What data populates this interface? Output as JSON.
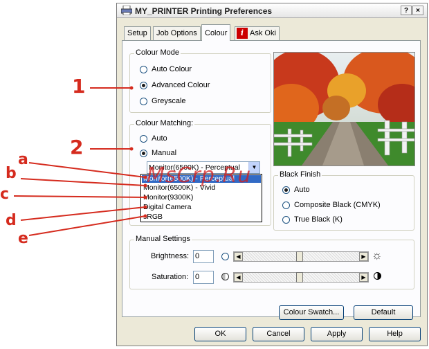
{
  "window": {
    "title": "MY_PRINTER Printing Preferences",
    "help_btn": "?",
    "close_btn": "×"
  },
  "tabs": [
    {
      "label": "Setup"
    },
    {
      "label": "Job Options"
    },
    {
      "label": "Colour"
    },
    {
      "label": "Ask Oki"
    }
  ],
  "colour_mode": {
    "title": "Colour Mode",
    "options": [
      "Auto Colour",
      "Advanced Colour",
      "Greyscale"
    ],
    "selected": 1
  },
  "colour_matching": {
    "title": "Colour Matching:",
    "options": [
      "Auto",
      "Manual"
    ],
    "selected": 1,
    "combo_value": "Monitor(6500K) - Perceptual",
    "list": [
      "Monitor(6500K) - Perceptual",
      "Monitor(6500K) - Vivid",
      "Monitor(9300K)",
      "Digital Camera",
      "sRGB"
    ],
    "list_selected": 0
  },
  "black_finish": {
    "title": "Black Finish",
    "options": [
      "Auto",
      "Composite Black (CMYK)",
      "True Black (K)"
    ],
    "selected": 0
  },
  "manual_settings": {
    "title": "Manual Settings",
    "brightness_label": "Brightness:",
    "brightness_value": "0",
    "saturation_label": "Saturation:",
    "saturation_value": "0"
  },
  "buttons": {
    "colour_swatch": "Colour Swatch...",
    "default": "Default",
    "ok": "OK",
    "cancel": "Cancel",
    "apply": "Apply",
    "help": "Help"
  },
  "callouts": {
    "one": "1",
    "two": "2",
    "a": "a",
    "b": "b",
    "c": "c",
    "d": "d",
    "e": "e"
  },
  "watermark": "MsCrp.Ru",
  "colors": {
    "callout": "#d52b1e",
    "selection": "#316ac5",
    "tab_icon": "#cc0000"
  },
  "icons": [
    "printer-icon",
    "info-icon",
    "sun-icon",
    "contrast-icon"
  ]
}
